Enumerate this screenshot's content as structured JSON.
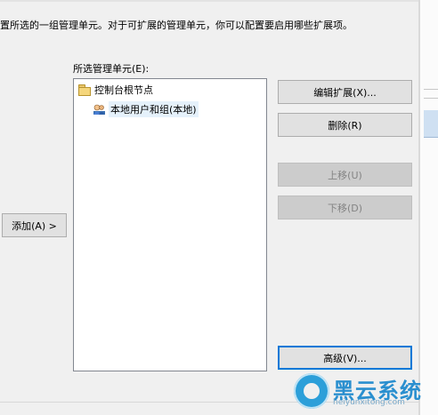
{
  "description": "置所选的一组管理单元。对于可扩展的管理单元，你可以配置要启用哪些扩展项。",
  "selected_snapins_label": "所选管理单元(E):",
  "tree": [
    {
      "label": "控制台根节点",
      "icon": "folder-icon"
    },
    {
      "label": "本地用户和组(本地)",
      "icon": "users-icon"
    }
  ],
  "buttons": {
    "edit_extensions": "编辑扩展(X)...",
    "delete": "删除(R)",
    "move_up": "上移(U)",
    "move_down": "下移(D)",
    "advanced": "高级(V)...",
    "add": "添加(A) >"
  },
  "watermark": {
    "brand": "黑云系统",
    "url": "heiyunxitong.com"
  },
  "colors": {
    "dialog_bg": "#f0f0f0",
    "focus_border": "#0078d7",
    "disabled_text": "#838383"
  }
}
